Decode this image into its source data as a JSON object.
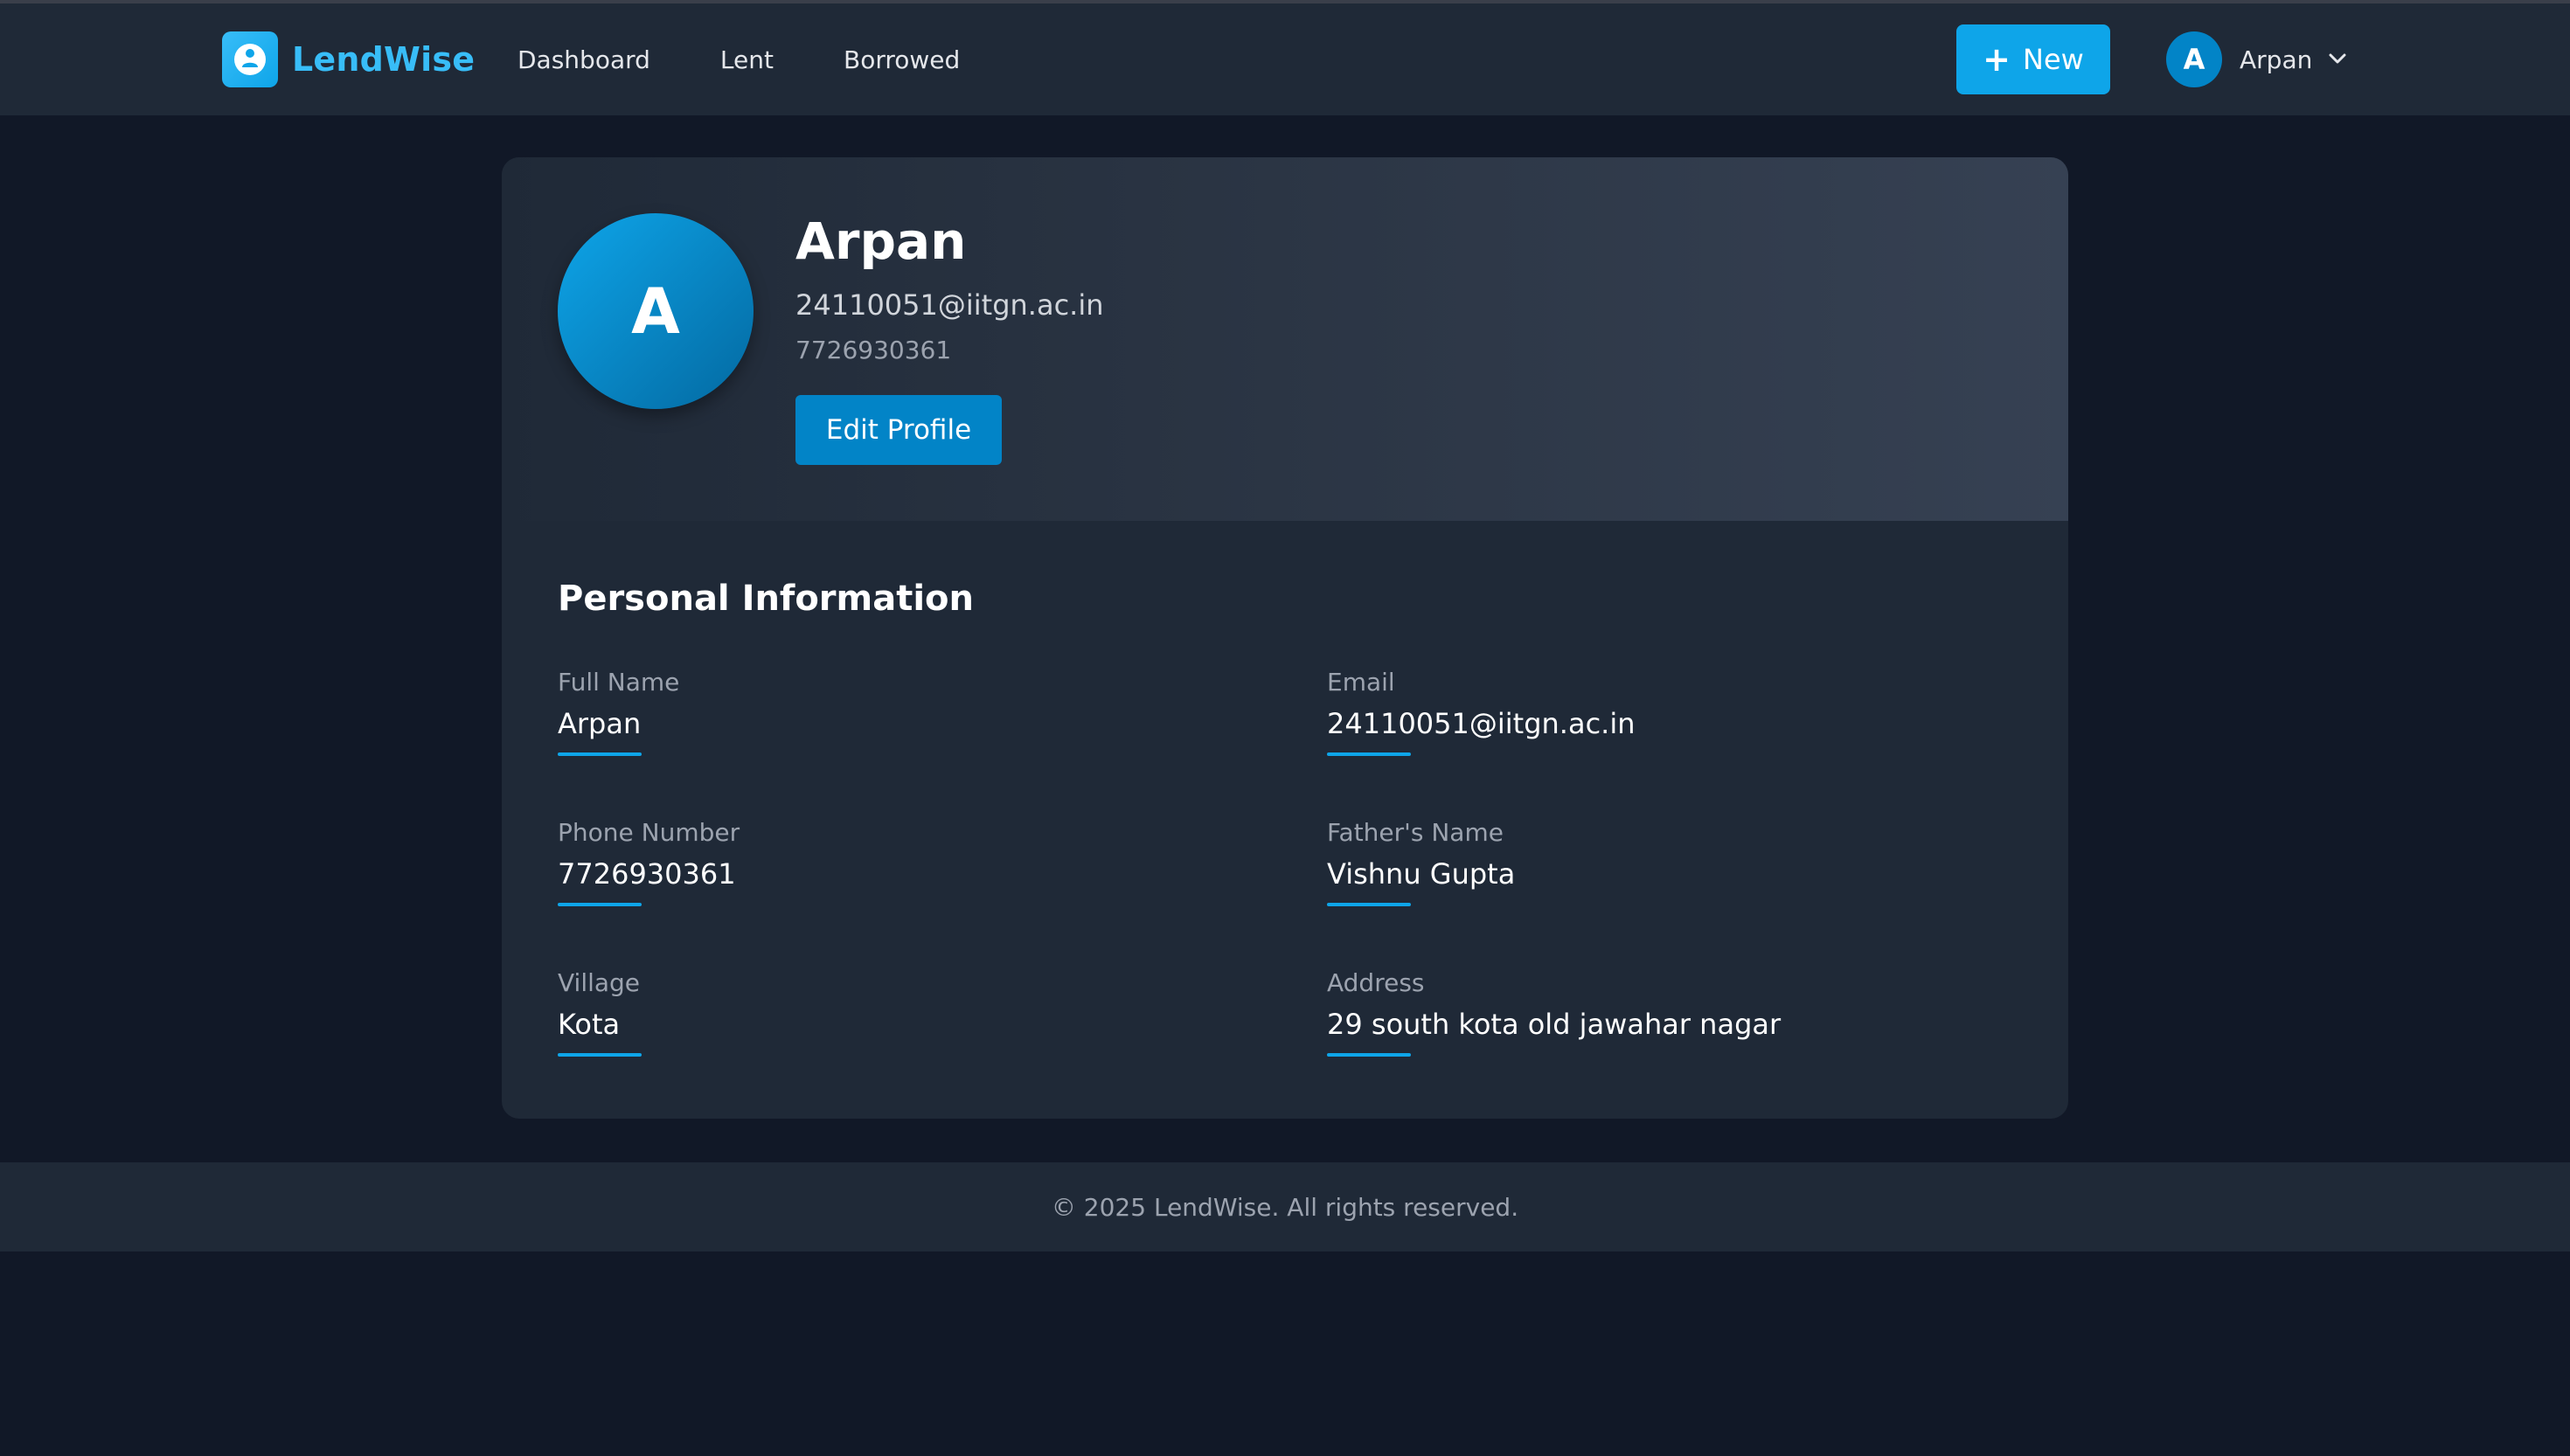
{
  "app": {
    "brand": "LendWise",
    "accent_color": "#0ea5e9",
    "icon": "user-icon"
  },
  "nav": {
    "links": [
      "Dashboard",
      "Lent",
      "Borrowed"
    ],
    "new_button": "New",
    "user": {
      "initial": "A",
      "name": "Arpan"
    }
  },
  "profile": {
    "initial": "A",
    "name": "Arpan",
    "email": "24110051@iitgn.ac.in",
    "phone": "7726930361",
    "edit_button": "Edit Profile"
  },
  "personal_info": {
    "title": "Personal Information",
    "fields": [
      {
        "label": "Full Name",
        "value": "Arpan"
      },
      {
        "label": "Email",
        "value": "24110051@iitgn.ac.in"
      },
      {
        "label": "Phone Number",
        "value": "7726930361"
      },
      {
        "label": "Father's Name",
        "value": "Vishnu Gupta"
      },
      {
        "label": "Village",
        "value": "Kota"
      },
      {
        "label": "Address",
        "value": "29 south kota old jawahar nagar"
      }
    ]
  },
  "footer": {
    "text": "© 2025 LendWise. All rights reserved."
  }
}
